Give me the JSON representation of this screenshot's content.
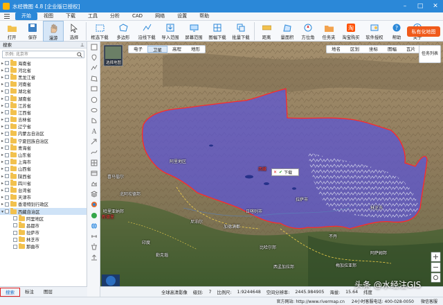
{
  "window": {
    "title": "水经微图 4.8 [企业版已授权]"
  },
  "menu": [
    "开始",
    "视图",
    "下载",
    "工具",
    "分析",
    "CAD",
    "网络",
    "设置",
    "帮助"
  ],
  "toolbar": [
    {
      "label": "打开",
      "icon": "folder-icon"
    },
    {
      "label": "保存",
      "icon": "save-icon"
    },
    {
      "label": "漫游",
      "icon": "hand-icon"
    },
    {
      "label": "选择",
      "icon": "pointer-icon"
    },
    {
      "label": "框选下载",
      "icon": "box-download-icon"
    },
    {
      "label": "多边形",
      "icon": "polygon-icon"
    },
    {
      "label": "沿线下载",
      "icon": "line-download-icon"
    },
    {
      "label": "导入范围",
      "icon": "import-icon"
    },
    {
      "label": "屏幕范围",
      "icon": "screen-icon"
    },
    {
      "label": "图幅下载",
      "icon": "sheet-icon"
    },
    {
      "label": "批量下载",
      "icon": "batch-icon"
    },
    {
      "label": "距离",
      "icon": "ruler-icon"
    },
    {
      "label": "量面积",
      "icon": "area-icon"
    },
    {
      "label": "方位角",
      "icon": "compass-icon"
    },
    {
      "label": "任务夹",
      "icon": "task-icon"
    },
    {
      "label": "淘宝购买",
      "icon": "taobao-icon"
    },
    {
      "label": "软件授权",
      "icon": "license-icon"
    },
    {
      "label": "帮助",
      "icon": "help-icon"
    },
    {
      "label": "关于",
      "icon": "about-icon"
    }
  ],
  "brand_button": "私有化地图",
  "panel": {
    "header": "搜索",
    "search_placeholder": "示例: 北京市",
    "tree": [
      {
        "label": "海南省",
        "expanded": false
      },
      {
        "label": "河北省",
        "expanded": false
      },
      {
        "label": "黑龙江省",
        "expanded": false
      },
      {
        "label": "河南省",
        "expanded": false
      },
      {
        "label": "湖北省",
        "expanded": false
      },
      {
        "label": "湖南省",
        "expanded": false
      },
      {
        "label": "江苏省",
        "expanded": false
      },
      {
        "label": "江西省",
        "expanded": false
      },
      {
        "label": "吉林省",
        "expanded": false
      },
      {
        "label": "辽宁省",
        "expanded": false
      },
      {
        "label": "内蒙古自治区",
        "expanded": false
      },
      {
        "label": "宁夏回族自治区",
        "expanded": false
      },
      {
        "label": "青海省",
        "expanded": false
      },
      {
        "label": "山东省",
        "expanded": false
      },
      {
        "label": "上海市",
        "expanded": false
      },
      {
        "label": "山西省",
        "expanded": false
      },
      {
        "label": "陕西省",
        "expanded": false
      },
      {
        "label": "四川省",
        "expanded": false
      },
      {
        "label": "台湾省",
        "expanded": false
      },
      {
        "label": "天津市",
        "expanded": false
      },
      {
        "label": "香港特别行政区",
        "expanded": false
      },
      {
        "label": "西藏自治区",
        "expanded": true,
        "selected": true
      },
      {
        "label": "阿里地区",
        "child": true
      },
      {
        "label": "昌都市",
        "child": true
      },
      {
        "label": "拉萨市",
        "child": true
      },
      {
        "label": "林芝市",
        "child": true
      },
      {
        "label": "那曲市",
        "child": true
      }
    ],
    "bottom_tabs": [
      "搜索",
      "标注",
      "图层"
    ]
  },
  "map": {
    "left_tabs": [
      "电子",
      "卫星",
      "高程",
      "地形"
    ],
    "active_left_tab": "卫星",
    "right_tabs": [
      "地名",
      "区划",
      "坐标",
      "图幅",
      "瓦片"
    ],
    "task_list": "任务列表",
    "map_switch": "选择地图",
    "popup": "下载",
    "labels": {
      "region": "西藏",
      "lhasa": "拉萨市",
      "nepal": "尼泊尔",
      "india": "印度",
      "bhutan": "不丹",
      "kathmandu": "加德满都",
      "nagari": "阿里地区",
      "shigatse": "日喀则市",
      "nyingchi": "林芝市",
      "uttarakhand": "北阿坎德邦",
      "himachal": "喜马偕尔",
      "haryana": "哈里亚纳邦",
      "bihar": "比哈尔邦",
      "west_bengal": "西孟加拉邦",
      "assam": "阿萨姆邦",
      "meghalaya": "梅加拉亚邦",
      "delhi": "新德里",
      "lucknow": "勒克瑙"
    }
  },
  "status": {
    "service": "全球高清影像",
    "level_label": "级别:",
    "level": "7",
    "scale_label": "比例尺:",
    "scale": "1:9244648",
    "res_label": "空间分辨率:",
    "resolution": "2445.984905",
    "unit_label": "海拔:",
    "elevation": "15.64",
    "extra": "纬度"
  },
  "footer": {
    "site": "官方网站: http://www.rivermap.cn",
    "hotline": "24小时客服电话: 400-028-0050",
    "service": "微信客服"
  },
  "watermark": "头条 @水经注GIS",
  "colors": {
    "titlebar": "#2b88d8",
    "brand": "#f05a1a",
    "highlight_fill": "#5a55d8",
    "boundary": "#ff2a2a"
  }
}
